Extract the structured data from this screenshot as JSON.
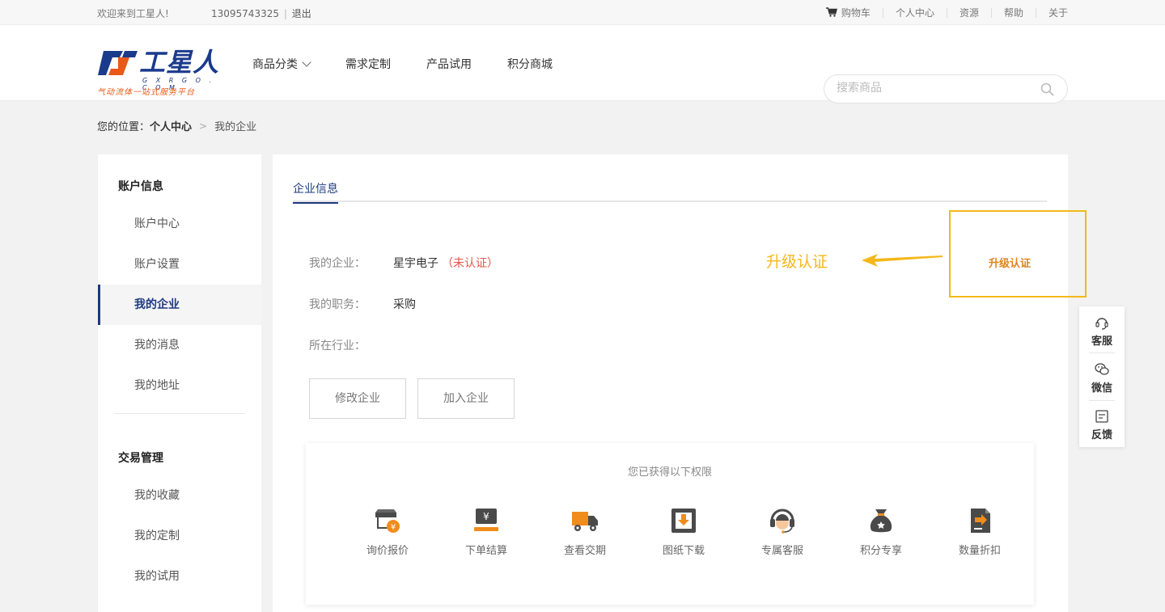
{
  "topbar": {
    "welcome": "欢迎来到工星人!",
    "phone": "13095743325",
    "separator": "|",
    "logout": "退出",
    "links": {
      "cart": "购物车",
      "user_center": "个人中心",
      "resources": "资源",
      "help": "帮助",
      "about": "关于"
    }
  },
  "header": {
    "logo": {
      "brand": "工星人",
      "domain": "G X R G O . C O M",
      "slogan": "气动流体一站式服务平台"
    },
    "nav": {
      "categories": "商品分类",
      "custom": "需求定制",
      "trial": "产品试用",
      "points_mall": "积分商城"
    },
    "search": {
      "placeholder": "搜索商品"
    }
  },
  "breadcrumb": {
    "prefix": "您的位置：",
    "parent": "个人中心",
    "arrow": ">",
    "current": "我的企业"
  },
  "sidebar": {
    "account": {
      "title": "账户信息",
      "items": [
        "账户中心",
        "账户设置",
        "我的企业",
        "我的消息",
        "我的地址"
      ]
    },
    "trade": {
      "title": "交易管理",
      "items": [
        "我的收藏",
        "我的定制",
        "我的试用"
      ]
    },
    "active_item": "我的企业"
  },
  "main": {
    "tab": "企业信息",
    "company": {
      "label": "我的企业：",
      "value": "星宇电子",
      "status": "（未认证）"
    },
    "position": {
      "label": "我的职务：",
      "value": "采购"
    },
    "industry": {
      "label": "所在行业：",
      "value": ""
    },
    "buttons": {
      "edit": "修改企业",
      "join": "加入企业"
    },
    "upgrade_button": "升级认证",
    "annotation": {
      "text": "升级认证",
      "color": "#f5b81a"
    },
    "permissions": {
      "title": "您已获得以下权限",
      "items": [
        {
          "label": "询价报价",
          "icon": "storefront-yen-icon"
        },
        {
          "label": "下单结算",
          "icon": "yen-checkout-icon"
        },
        {
          "label": "查看交期",
          "icon": "truck-icon"
        },
        {
          "label": "图纸下载",
          "icon": "download-box-icon"
        },
        {
          "label": "专属客服",
          "icon": "headset-agent-icon"
        },
        {
          "label": "积分专享",
          "icon": "money-bag-icon"
        },
        {
          "label": "数量折扣",
          "icon": "document-arrow-icon"
        }
      ]
    }
  },
  "floating": {
    "service": "客服",
    "wechat": "微信",
    "feedback": "反馈"
  },
  "colors": {
    "brand_navy": "#1d3a80",
    "accent_orange": "#e0841a",
    "unverified_red": "#e5554a",
    "annotation_yellow": "#f5b81a"
  }
}
